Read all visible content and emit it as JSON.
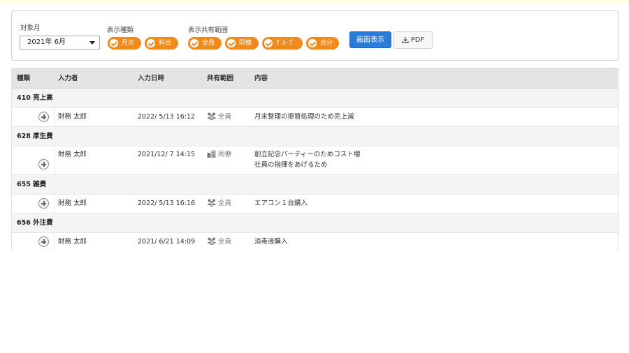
{
  "filters": {
    "month": {
      "label": "対象月",
      "value": "2021年 6月"
    },
    "display_type": {
      "label": "表示種類",
      "options": [
        "月次",
        "科目"
      ]
    },
    "share_scope": {
      "label": "表示共有範囲",
      "options": [
        "全員",
        "同僚",
        "ｸﾞﾙｰﾌﾟ",
        "自分"
      ]
    },
    "show_button": "画面表示",
    "pdf_button": "PDF",
    "accent_color": "#f08a1c",
    "button_color": "#2b7bd8"
  },
  "table": {
    "headers": [
      "種類",
      "入力者",
      "入力日時",
      "共有範囲",
      "内容"
    ],
    "groups": [
      {
        "title": "410 売上高",
        "rows": [
          {
            "user": "財務 太郎",
            "datetime": "2022/ 5/13 16:12",
            "scope": "全員",
            "scope_icon": "group-icon",
            "content": [
              "月末整理の振替処理のため売上減"
            ]
          }
        ]
      },
      {
        "title": "628 厚生費",
        "rows": [
          {
            "user": "財務 太郎",
            "datetime": "2021/12/ 7 14:15",
            "scope": "同僚",
            "scope_icon": "colleague-icon",
            "content": [
              "創立記念パーティーのためコスト増",
              "社員の指揮をあげるため"
            ]
          }
        ]
      },
      {
        "title": "655 雑費",
        "rows": [
          {
            "user": "財務 太郎",
            "datetime": "2022/ 5/13 16:16",
            "scope": "全員",
            "scope_icon": "group-icon",
            "content": [
              "エアコン１台購入"
            ]
          }
        ]
      },
      {
        "title": "656 外注費",
        "rows": [
          {
            "user": "財務 太郎",
            "datetime": "2021/ 6/21 14:09",
            "scope": "全員",
            "scope_icon": "group-icon",
            "content": [
              "消毒液購入"
            ]
          }
        ]
      }
    ]
  }
}
